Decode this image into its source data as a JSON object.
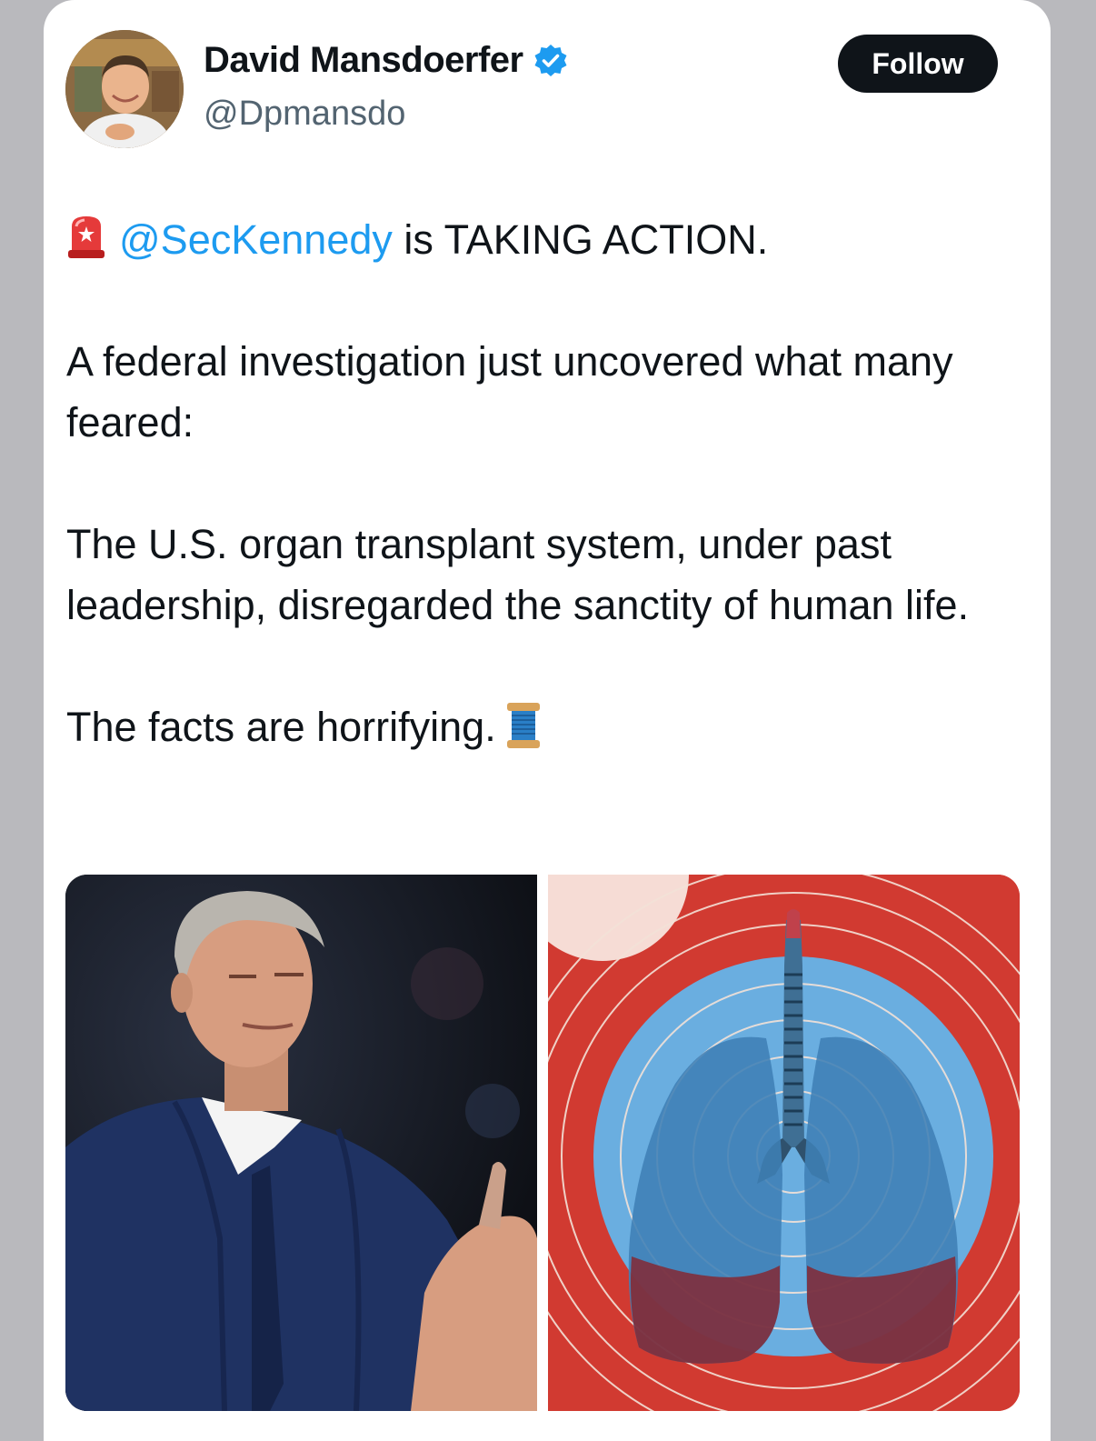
{
  "author": {
    "display_name": "David Mansdoerfer",
    "handle": "@Dpmansdo",
    "verified": true,
    "avatar_icon": "profile-photo"
  },
  "follow_button": {
    "label": "Follow"
  },
  "tweet": {
    "line1": {
      "emoji": "siren-emoji",
      "mention": "@SecKennedy",
      "text": " is TAKING ACTION."
    },
    "paragraph2": "A federal investigation just uncovered what many feared:",
    "paragraph3": "The U.S. organ transplant system, under past leadership, disregarded the sanctity of human life.",
    "paragraph4": {
      "text": "The facts are horrifying.",
      "emoji": "spool-of-thread-emoji"
    }
  },
  "media": [
    {
      "kind": "photo",
      "subject": "man-in-suit-photo"
    },
    {
      "kind": "illustration",
      "subject": "lungs-illustration"
    }
  ],
  "colors": {
    "link": "#1d9bf0",
    "text": "#0f1419",
    "secondary_text": "#536471",
    "button_bg": "#0f1419",
    "verified_badge": "#1d9bf0",
    "lungs_background": "#d13a31",
    "lungs_circle": "#6aaee0"
  }
}
